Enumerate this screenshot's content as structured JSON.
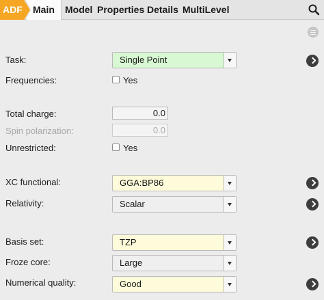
{
  "tabs": [
    {
      "label": "ADF"
    },
    {
      "label": "Main"
    },
    {
      "label": "Model"
    },
    {
      "label": "Properties"
    },
    {
      "label": "Details"
    },
    {
      "label": "MultiLevel"
    }
  ],
  "icons": {
    "search": "magnifier-icon",
    "menu": "hamburger-icon",
    "details": "chevron-right-icon"
  },
  "colors": {
    "accent": "#f5a623",
    "task_field": "#d7f8d2",
    "changed_field": "#fdfbd9"
  },
  "form": {
    "task": {
      "label": "Task:",
      "value": "Single Point"
    },
    "frequencies": {
      "label": "Frequencies:",
      "checkbox_label": "Yes"
    },
    "total_charge": {
      "label": "Total charge:",
      "value": "0.0"
    },
    "spin_polarization": {
      "label": "Spin polarization:",
      "value": "0.0"
    },
    "unrestricted": {
      "label": "Unrestricted:",
      "checkbox_label": "Yes"
    },
    "xc_functional": {
      "label": "XC functional:",
      "value": "GGA:BP86"
    },
    "relativity": {
      "label": "Relativity:",
      "value": "Scalar"
    },
    "basis_set": {
      "label": "Basis set:",
      "value": "TZP"
    },
    "froze_core": {
      "label": "Froze core:",
      "value": "Large"
    },
    "numerical_quality": {
      "label": "Numerical quality:",
      "value": "Good"
    }
  }
}
